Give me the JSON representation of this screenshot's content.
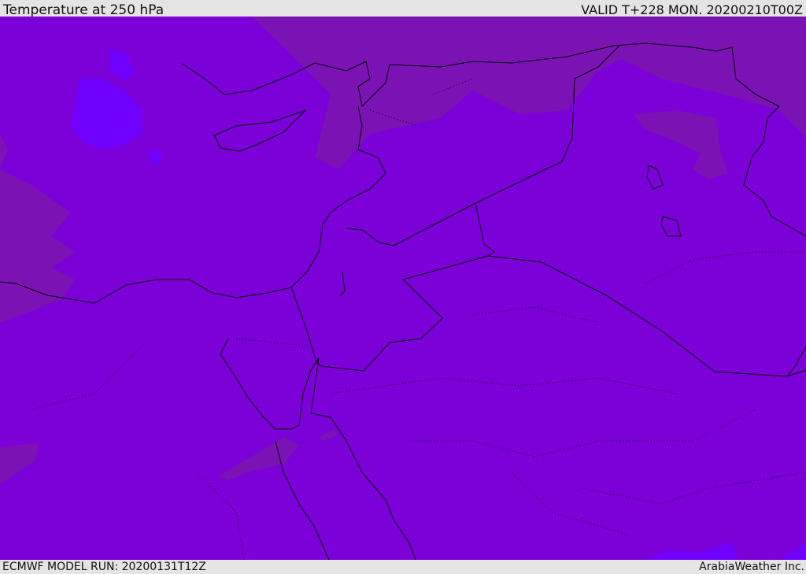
{
  "header": {
    "title": "Temperature at 250 hPa",
    "valid": "VALID T+228 MON. 20200210T00Z"
  },
  "footer": {
    "model_run": "ECMWF MODEL RUN: 20200131T12Z",
    "credit": "ArabiaWeather Inc."
  },
  "colors": {
    "base": "#7c00d8",
    "warm": "#7a12b4",
    "cold": "#7000ff",
    "border": "#000000",
    "chrome": "#e4e4e4"
  }
}
